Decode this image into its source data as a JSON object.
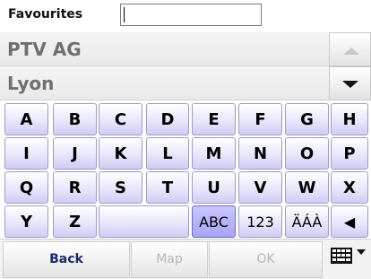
{
  "header": {
    "label": "Favourites",
    "search_value": ""
  },
  "results": [
    {
      "text": "PTV AG"
    },
    {
      "text": "Lyon"
    }
  ],
  "keyboard": {
    "rows": [
      [
        "A",
        "B",
        "C",
        "D",
        "E",
        "F",
        "G",
        "H"
      ],
      [
        "I",
        "J",
        "K",
        "L",
        "M",
        "N",
        "O",
        "P"
      ],
      [
        "Q",
        "R",
        "S",
        "T",
        "U",
        "V",
        "W",
        "X"
      ],
      [
        "Y",
        "Z"
      ]
    ],
    "space_label": "",
    "mode_abc": "ABC",
    "mode_123": "123",
    "mode_accents": "ÄÁÀ",
    "backspace": "◀"
  },
  "bottom_bar": {
    "back": "Back",
    "map": "Map",
    "ok": "OK"
  },
  "colors": {
    "key_top": "#ffffff",
    "key_bottom": "#cfcdf3",
    "key_active": "#a8a4f4",
    "disabled_text": "#b7b7b7"
  }
}
